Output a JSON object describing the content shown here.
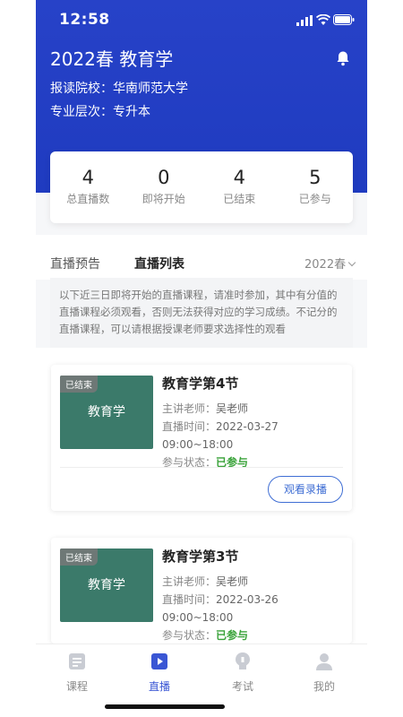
{
  "status_bar": {
    "time": "12:58"
  },
  "header": {
    "title": "2022春 教育学",
    "school_label": "报读院校：",
    "school": "华南师范大学",
    "level_label": "专业层次：",
    "level": "专升本"
  },
  "stats": [
    {
      "value": "4",
      "label": "总直播数"
    },
    {
      "value": "0",
      "label": "即将开始"
    },
    {
      "value": "4",
      "label": "已结束"
    },
    {
      "value": "5",
      "label": "已参与"
    }
  ],
  "tabs": {
    "preview": "直播预告",
    "list": "直播列表",
    "term": "2022春"
  },
  "notice": "以下近三日即将开始的直播课程，请准时参加，其中有分值的直播课程必须观看，否则无法获得对应的学习成绩。不记分的直播课程，可以请根据授课老师要求选择性的观看",
  "courses": [
    {
      "badge": "已结束",
      "thumb_text": "教育学",
      "title": "教育学第4节",
      "teacher_label": "主讲老师：",
      "teacher": "吴老师",
      "time_label": "直播时间：",
      "time": "2022-03-27 09:00~18:00",
      "state_label": "参与状态：",
      "state": "已参与",
      "button": "观看录播"
    },
    {
      "badge": "已结束",
      "thumb_text": "教育学",
      "title": "教育学第3节",
      "teacher_label": "主讲老师：",
      "teacher": "吴老师",
      "time_label": "直播时间：",
      "time": "2022-03-26 09:00~18:00",
      "state_label": "参与状态：",
      "state": "已参与"
    }
  ],
  "bottom_nav": [
    {
      "label": "课程",
      "icon": "course-icon"
    },
    {
      "label": "直播",
      "icon": "live-icon",
      "active": true
    },
    {
      "label": "考试",
      "icon": "exam-icon"
    },
    {
      "label": "我的",
      "icon": "profile-icon"
    }
  ],
  "colors": {
    "header_bg": "#2742c8",
    "accent": "#3a56d4",
    "success": "#3aa33a",
    "thumb_bg": "#3b7a6a"
  }
}
